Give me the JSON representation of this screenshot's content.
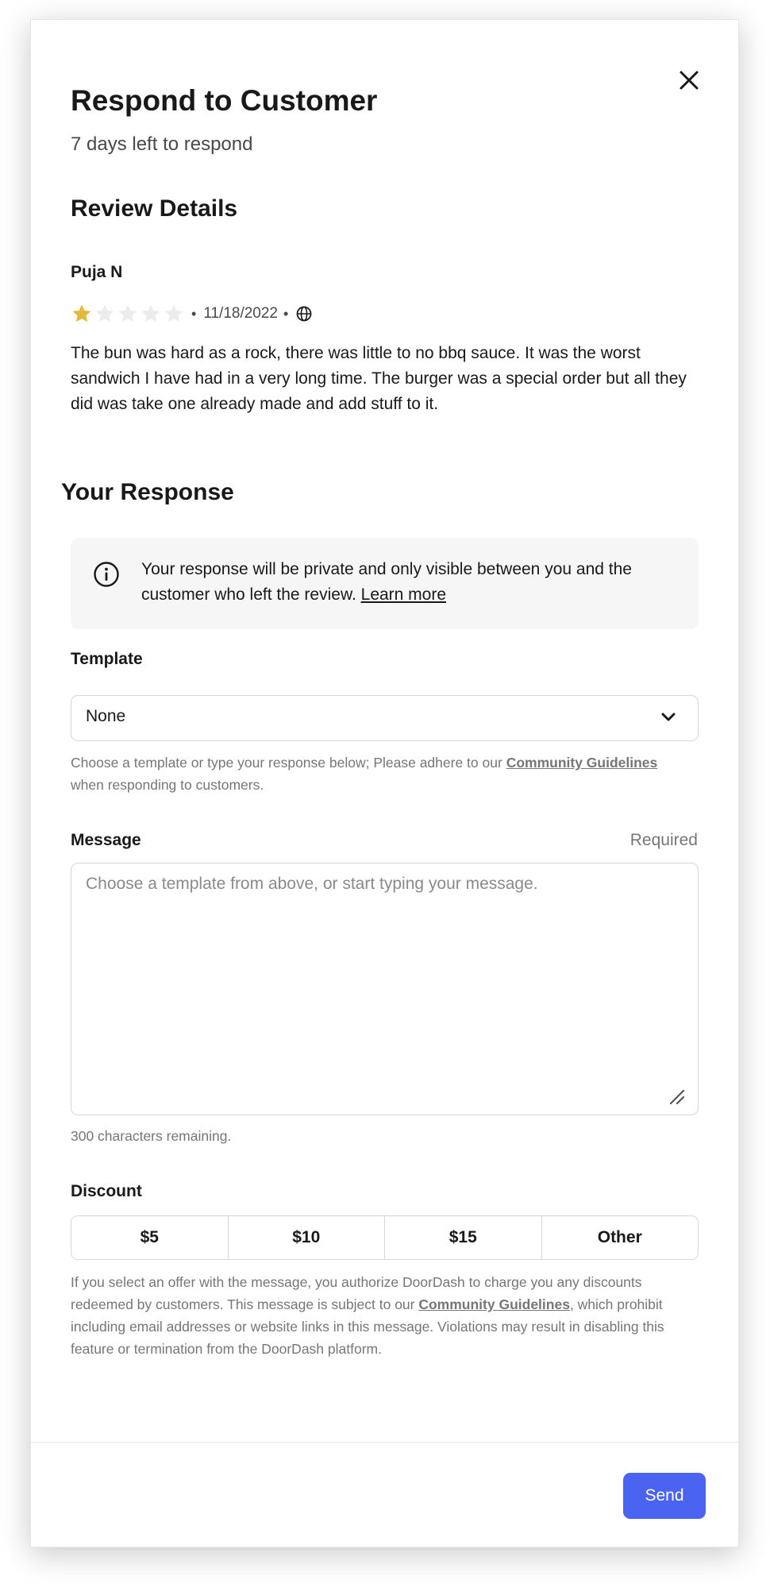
{
  "dialog": {
    "title": "Respond to Customer",
    "subtitle": "7 days left to respond",
    "close_icon": "close-icon"
  },
  "review": {
    "section_title": "Review Details",
    "reviewer": "Puja N",
    "rating": 1,
    "max_rating": 5,
    "star_color": "#e3b93b",
    "date": "11/18/2022",
    "channel_icon": "globe-icon",
    "text": "The bun was hard as a rock, there was little to no bbq sauce. It was the worst sandwich I have had in a very long time. The burger was a special order but all they did was take one already made and add stuff to it."
  },
  "response": {
    "section_title": "Your Response",
    "info": {
      "icon": "info-icon",
      "text": "Your response will be private and only visible between you and the customer who left the review.",
      "link": "Learn more"
    },
    "template": {
      "label": "Template",
      "value": "None",
      "helper_before": "Choose a template or type your response below; Please adhere to our",
      "helper_link": "Community Guidelines",
      "helper_after": "when responding to customers."
    },
    "message": {
      "label": "Message",
      "required": "Required",
      "placeholder": "Choose a template from above, or start typing your message.",
      "remaining": "300 characters remaining."
    },
    "discount": {
      "label": "Discount",
      "options": [
        "$5",
        "$10",
        "$15",
        "Other"
      ],
      "disclaimer_before": "If you select an offer with the message, you authorize DoorDash to charge you any discounts redeemed by customers. This message is subject to our",
      "disclaimer_link": "Community Guidelines",
      "disclaimer_after": ", which prohibit including email addresses or website links in this message. Violations may result in disabling this feature or termination from the DoorDash platform."
    }
  },
  "footer": {
    "send_label": "Send",
    "accent_color": "#4a63f0"
  }
}
